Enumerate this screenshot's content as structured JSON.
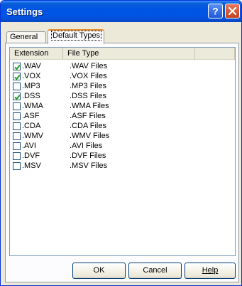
{
  "window": {
    "title": "Settings"
  },
  "tabs": [
    {
      "label": "General"
    },
    {
      "label": "Default Types"
    }
  ],
  "list": {
    "columns": [
      "Extension",
      "File Type"
    ],
    "rows": [
      {
        "ext": ".WAV",
        "type": ".WAV Files",
        "checked": true
      },
      {
        "ext": ".VOX",
        "type": ".VOX Files",
        "checked": true
      },
      {
        "ext": ".MP3",
        "type": ".MP3 Files",
        "checked": false
      },
      {
        "ext": ".DSS",
        "type": ".DSS Files",
        "checked": true
      },
      {
        "ext": ".WMA",
        "type": ".WMA Files",
        "checked": false
      },
      {
        "ext": ".ASF",
        "type": ".ASF Files",
        "checked": false
      },
      {
        "ext": ".CDA",
        "type": ".CDA Files",
        "checked": false
      },
      {
        "ext": ".WMV",
        "type": ".WMV Files",
        "checked": false
      },
      {
        "ext": ".AVI",
        "type": ".AVI Files",
        "checked": false
      },
      {
        "ext": ".DVF",
        "type": ".DVF Files",
        "checked": false
      },
      {
        "ext": ".MSV",
        "type": ".MSV Files",
        "checked": false
      }
    ]
  },
  "buttons": {
    "ok": "OK",
    "cancel": "Cancel",
    "help": "Help"
  },
  "colors": {
    "titlebar": "#0054e3",
    "dialog_bg": "#ece9d8",
    "active_tab_accent": "#e68b2c"
  }
}
